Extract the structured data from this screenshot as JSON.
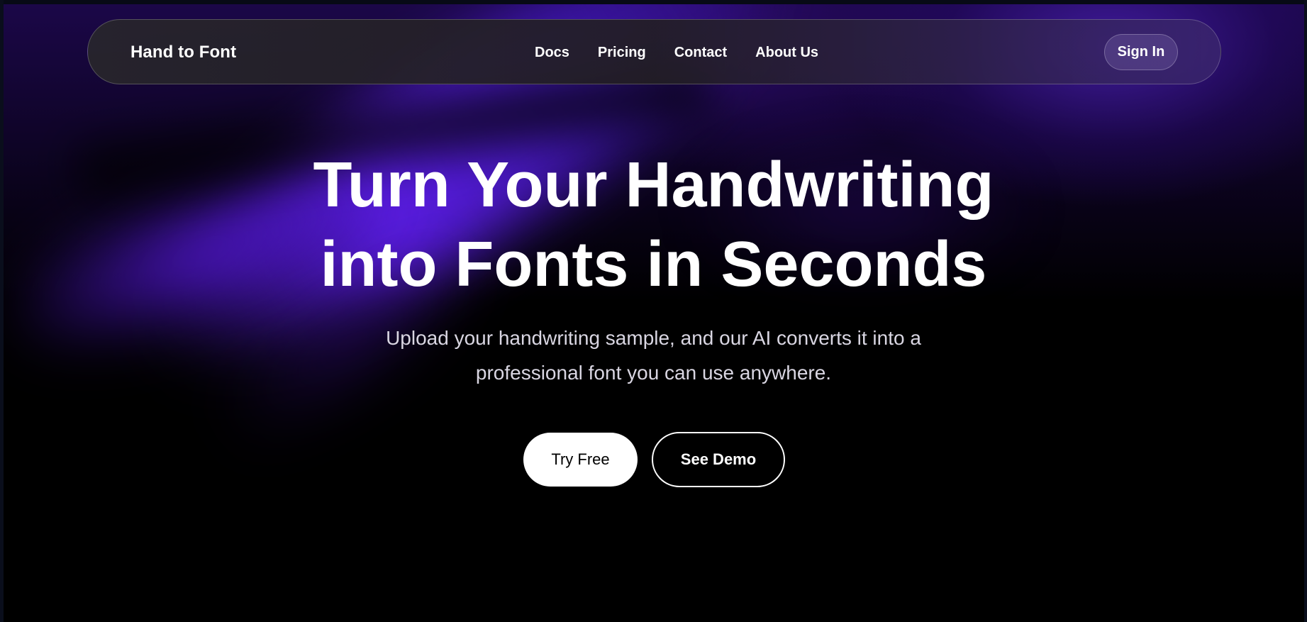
{
  "nav": {
    "brand": "Hand to Font",
    "links": [
      {
        "label": "Docs"
      },
      {
        "label": "Pricing"
      },
      {
        "label": "Contact"
      },
      {
        "label": "About Us"
      }
    ],
    "sign_in_label": "Sign In"
  },
  "hero": {
    "title_lines": [
      "Turn Your Handwriting",
      "into Fonts in Seconds"
    ],
    "subtitle_lines": [
      "Upload your handwriting sample, and our AI converts it into a",
      "professional font you can use anywhere."
    ],
    "primary_cta": "Try Free",
    "secondary_cta": "See Demo"
  },
  "colors": {
    "accent": "#5b1ee6",
    "background": "#000000",
    "text": "#ffffff"
  }
}
